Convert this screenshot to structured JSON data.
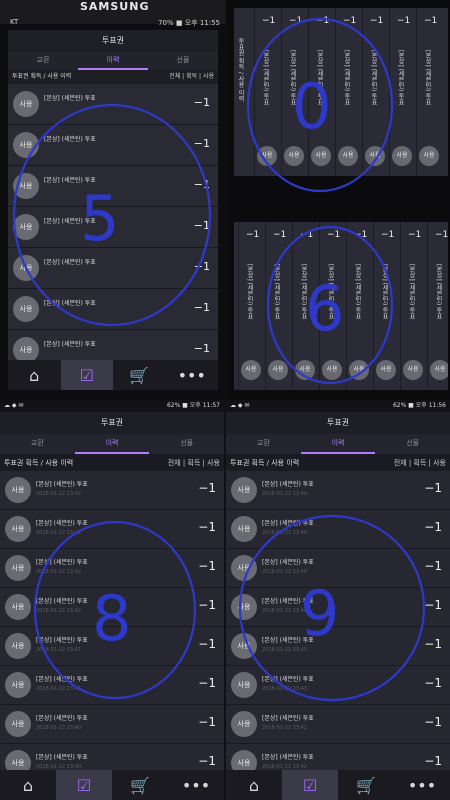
{
  "photo": {
    "brand": "SAMSUNG",
    "status_left": "KT",
    "status_right": "70% ■ 오후 11:55"
  },
  "app": {
    "title": "투표권",
    "tabs": [
      "교환",
      "이력",
      "선물"
    ],
    "history_label": "투표권 획득 / 사용 이력",
    "filters": "전체 | 획득 | 사용"
  },
  "row": {
    "badge": "사용",
    "text": "[본상] (세븐틴) 투표",
    "value": "−1"
  },
  "screenshot_left": {
    "status_right": "62% ■ 오후 11:57",
    "dates": [
      "2018-01-22 23:42",
      "2018-01-22 23:42",
      "2018-01-22 23:42",
      "2018-01-22 23:42",
      "2018-01-22 23:41",
      "2018-01-22 23:41",
      "2018-01-22 23:40",
      "2018-01-22 23:40"
    ]
  },
  "screenshot_right": {
    "status_right": "62% ■ 오후 11:56",
    "dates": [
      "2018-01-22 23:44",
      "2018-01-22 23:44",
      "2018-01-22 23:44",
      "2018-01-22 23:44",
      "2018-01-22 23:43",
      "2018-01-22 23:43",
      "2018-01-22 23:42",
      "2018-01-22 23:42"
    ]
  },
  "annotations": [
    "5",
    "0",
    "6",
    "8",
    "9"
  ]
}
